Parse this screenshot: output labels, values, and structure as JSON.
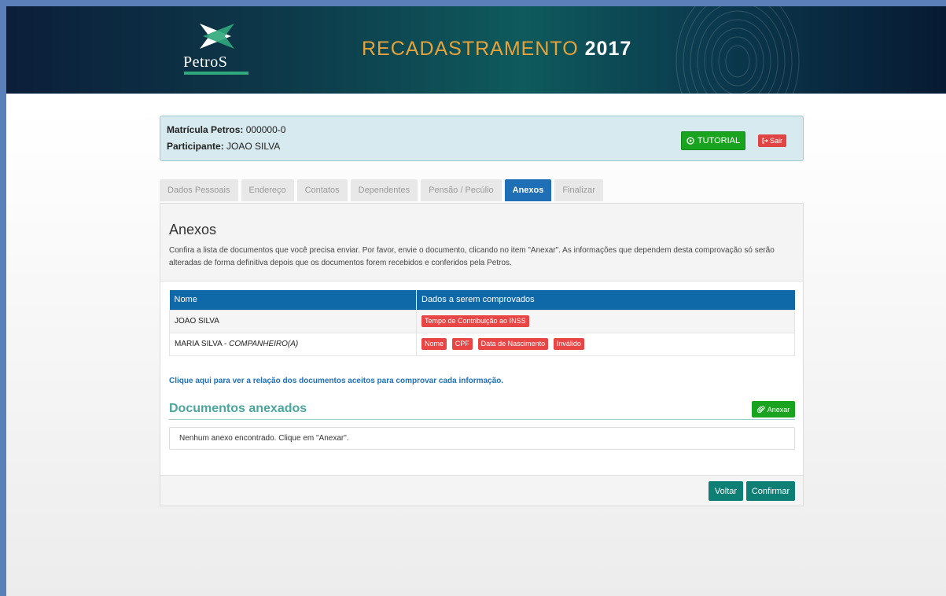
{
  "header": {
    "logo_text": "PetroS",
    "title_main": "RECADASTRAMENTO ",
    "title_year": "2017",
    "colors": {
      "accent": "#e7a33a",
      "brand_green": "#2fa87b"
    }
  },
  "info": {
    "matricula_label": "Matrícula Petros:",
    "matricula_value": "000000-0",
    "participante_label": "Participante:",
    "participante_value": "JOAO SILVA",
    "tutorial_label": "TUTORIAL",
    "sair_label": "Sair"
  },
  "tabs": [
    {
      "label": "Dados Pessoais",
      "active": false
    },
    {
      "label": "Endereço",
      "active": false
    },
    {
      "label": "Contatos",
      "active": false
    },
    {
      "label": "Dependentes",
      "active": false
    },
    {
      "label": "Pensão / Pecúlio",
      "active": false
    },
    {
      "label": "Anexos",
      "active": true
    },
    {
      "label": "Finalizar",
      "active": false
    }
  ],
  "panel": {
    "title": "Anexos",
    "description": "Confira a lista de documentos que você precisa enviar. Por favor, envie o documento, clicando no item \"Anexar\". As informações que dependem desta comprovação só serão alteradas de forma definitiva depois que os documentos forem recebidos e conferidos pela Petros.",
    "table": {
      "headers": [
        "Nome",
        "Dados a serem comprovados"
      ],
      "rows": [
        {
          "name": "JOAO SILVA",
          "relation": "",
          "tags": [
            "Tempo de Contribuição ao INSS"
          ]
        },
        {
          "name": "MARIA SILVA - ",
          "relation": "COMPANHEIRO(A)",
          "tags": [
            "Nome",
            "CPF",
            "Data de Nascimento",
            "Inválido"
          ]
        }
      ]
    },
    "link_text": "Clique aqui para ver a relação dos documentos aceitos para comprovar cada informação.",
    "attached_title": "Documentos anexados",
    "anexar_label": "Anexar",
    "empty_text": "Nenhum anexo encontrado. Clique em \"Anexar\".",
    "voltar_label": "Voltar",
    "confirmar_label": "Confirmar"
  }
}
